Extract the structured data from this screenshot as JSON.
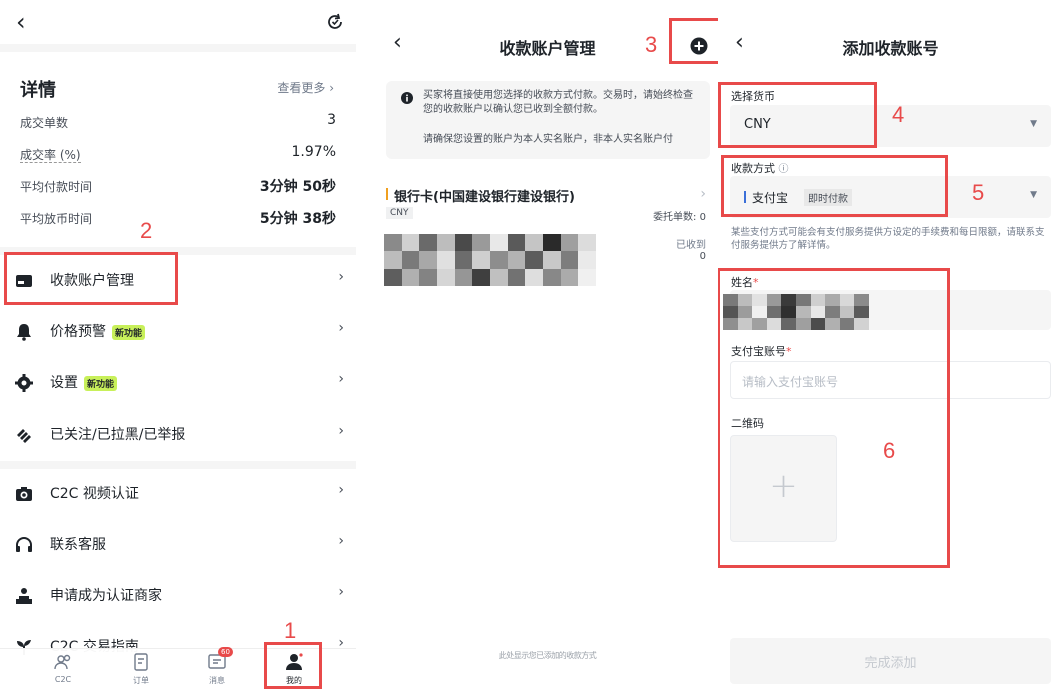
{
  "panel1": {
    "back_icon": "‹",
    "top_right_icon": "refresh-icon",
    "details": {
      "title": "详情",
      "see_more": "查看更多 ›",
      "rows": [
        {
          "label": "成交单数",
          "value": "3"
        },
        {
          "label": "成交率 (%)",
          "value": "1.97%"
        },
        {
          "label": "平均付款时间",
          "value": "3分钟 50秒"
        },
        {
          "label": "平均放币时间",
          "value": "5分钟 38秒"
        }
      ]
    },
    "menu": [
      {
        "label": "收款账户管理",
        "badge": ""
      },
      {
        "label": "价格预警",
        "badge": "新功能"
      },
      {
        "label": "设置",
        "badge": "新功能"
      },
      {
        "label": "已关注/已拉黑/已举报",
        "badge": ""
      },
      {
        "label": "C2C 视频认证",
        "badge": ""
      },
      {
        "label": "联系客服",
        "badge": ""
      },
      {
        "label": "申请成为认证商家",
        "badge": ""
      },
      {
        "label": "C2C 交易指南",
        "badge": ""
      }
    ],
    "bottom_nav": [
      {
        "label": "C2C"
      },
      {
        "label": "订单"
      },
      {
        "label": "消息",
        "badge": "60"
      },
      {
        "label": "我的"
      }
    ],
    "step_markers": [
      "1",
      "2"
    ]
  },
  "panel2": {
    "title": "收款账户管理",
    "notice_line1": "买家将直接使用您选择的收款方式付款。交易时，请始终检查您的收款账户以确认您已收到全额付款。",
    "notice_line2": "请确保您设置的账户为本人实名账户，非本人实名账户付",
    "account": {
      "name": "银行卡(中国建设银行建设银行)",
      "currency": "CNY",
      "entrust_label": "委托单数:",
      "entrust_value": "0",
      "received_label": "已收到",
      "received_value": "0"
    },
    "footer_text": "此处显示您已添加的收款方式",
    "step_marker": "3"
  },
  "panel3": {
    "title": "添加收款账号",
    "currency_label": "选择货币",
    "currency_value": "CNY",
    "method_label": "收款方式",
    "method_value": "支付宝",
    "method_tag": "即时付款",
    "method_note": "某些支付方式可能会有支付服务提供方设定的手续费和每日限额，请联系支付服务提供方了解详情。",
    "name_label": "姓名",
    "account_label": "支付宝账号",
    "account_placeholder": "请输入支付宝账号",
    "qr_label": "二维码",
    "qr_add": "+",
    "submit_label": "完成添加",
    "step_markers": [
      "4",
      "5",
      "6"
    ]
  },
  "colors": {
    "annotation_red": "#e84a4a",
    "badge_green": "#c8f05a",
    "accent_orange": "#f0a020",
    "method_blue": "#3b6fd8",
    "text_dark": "#1e2329",
    "text_muted": "#707a8a"
  }
}
